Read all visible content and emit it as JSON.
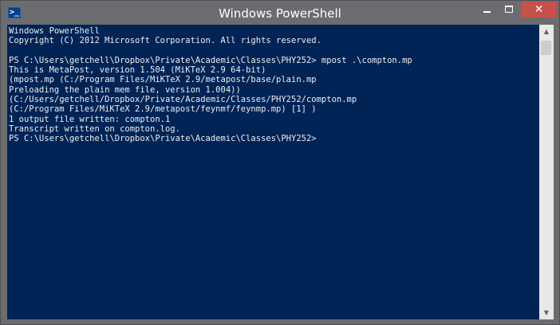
{
  "window": {
    "title": "Windows PowerShell",
    "icon_glyph": ">_",
    "icon_name": "powershell-icon",
    "minimize_icon": "minimize-icon",
    "maximize_icon": "maximize-icon",
    "close_icon": "close-icon",
    "close_glyph": "✕"
  },
  "colors": {
    "console_background": "#012456",
    "console_text": "#eeedf0",
    "titlebar": "#6b6c70",
    "close_button": "#c7504a"
  },
  "console": {
    "lines": [
      "Windows PowerShell",
      "Copyright (C) 2012 Microsoft Corporation. All rights reserved.",
      "",
      "PS C:\\Users\\getchell\\Dropbox\\Private\\Academic\\Classes\\PHY252> mpost .\\compton.mp",
      "This is MetaPost, version 1.504 (MiKTeX 2.9 64-bit)",
      "(mpost.mp (C:/Program Files/MiKTeX 2.9/metapost/base/plain.mp",
      "Preloading the plain mem file, version 1.004))",
      "(C:/Users/getchell/Dropbox/Private/Academic/Classes/PHY252/compton.mp",
      "(C:/Program Files/MiKTeX 2.9/metapost/feynmf/feynmp.mp) [1] )",
      "1 output file written: compton.1",
      "Transcript written on compton.log.",
      "PS C:\\Users\\getchell\\Dropbox\\Private\\Academic\\Classes\\PHY252>"
    ]
  },
  "scrollbar": {
    "up_icon": "scroll-up-arrow-icon",
    "down_icon": "scroll-down-arrow-icon",
    "up_glyph": "▲",
    "down_glyph": "▼"
  }
}
